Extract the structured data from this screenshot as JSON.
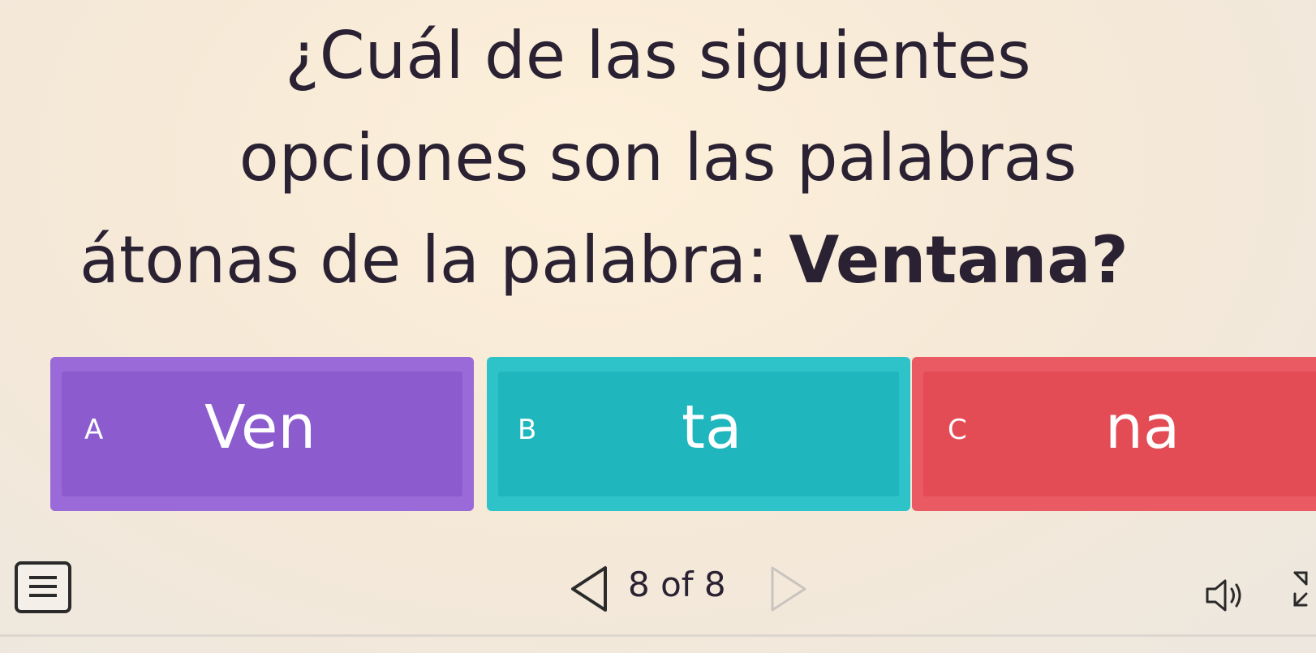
{
  "question": {
    "line1": "¿Cuál de las siguientes",
    "line2": "opciones son las palabras",
    "line3_prefix": "átonas de la palabra: ",
    "line3_word": "Ventana",
    "line3_suffix": "?"
  },
  "options": [
    {
      "letter": "A",
      "syllable": "Ven",
      "color": "#8c5ccf"
    },
    {
      "letter": "B",
      "syllable": "ta",
      "color": "#1fb7bd"
    },
    {
      "letter": "C",
      "syllable": "na",
      "color": "#e34c55"
    }
  ],
  "navigation": {
    "page_indicator": "8 of 8",
    "menu_icon": "hamburger-menu-icon",
    "prev_icon": "triangle-left-icon",
    "next_icon": "triangle-right-icon",
    "audio_icon": "speaker-icon",
    "expand_icon": "expand-icon"
  }
}
